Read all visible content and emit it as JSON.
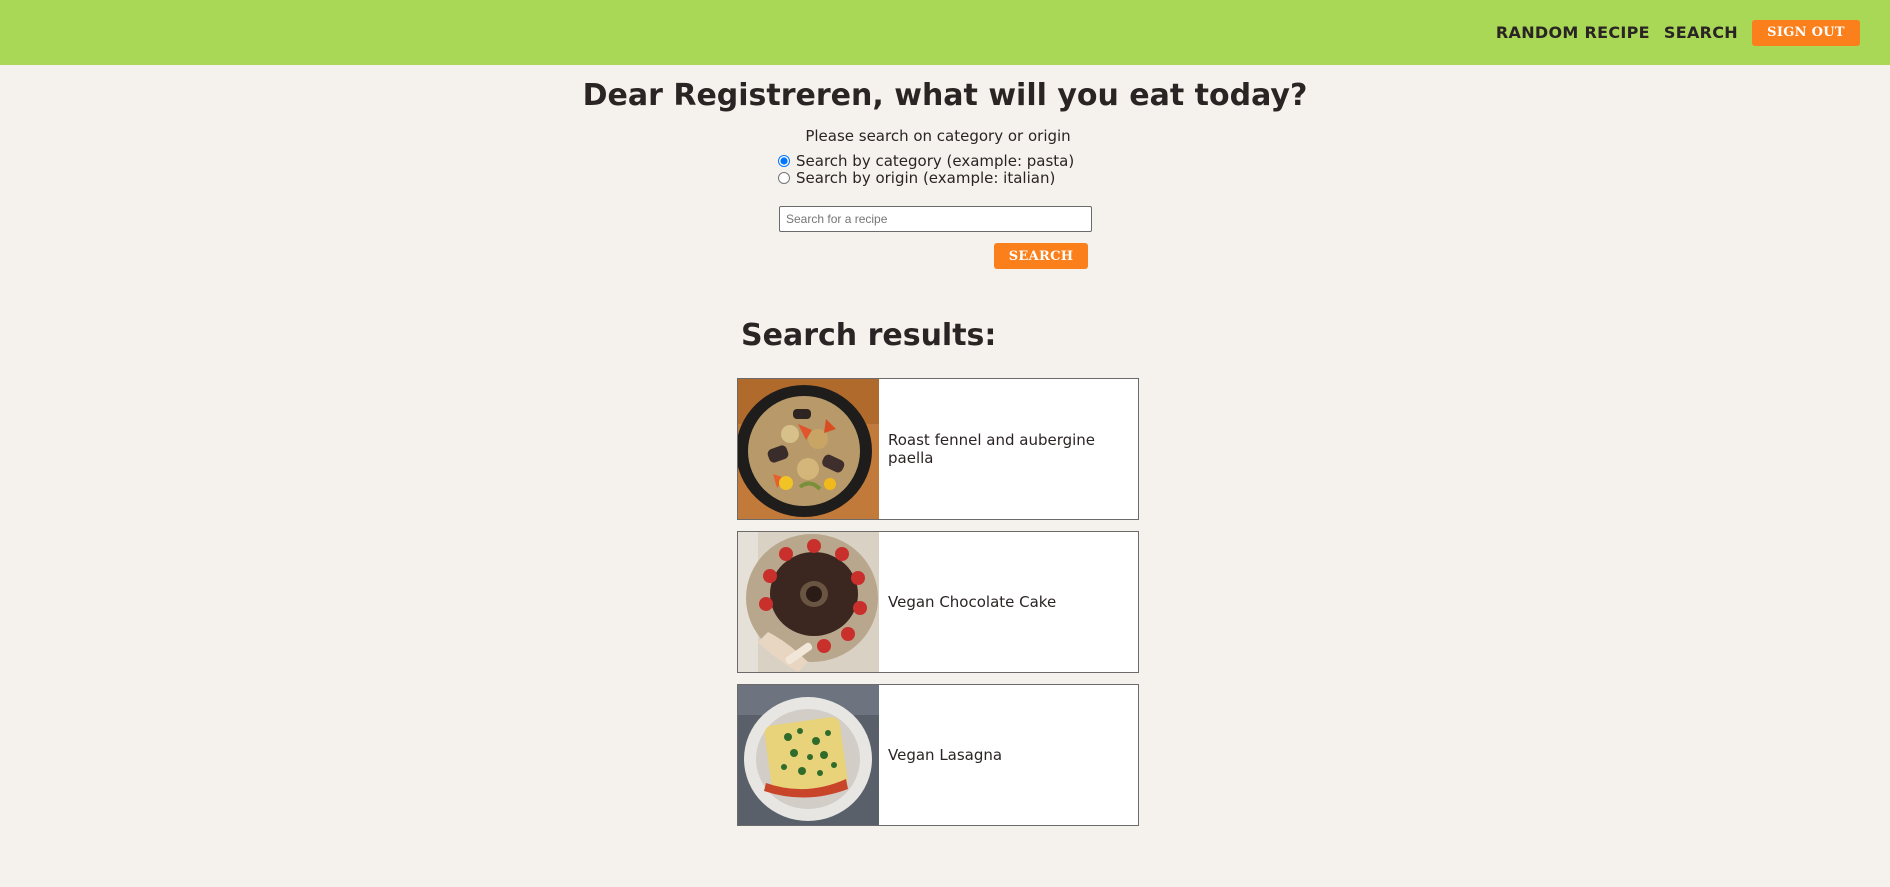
{
  "header": {
    "nav": {
      "random_recipe": "RANDOM RECIPE",
      "search": "SEARCH",
      "sign_out": "SIGN OUT"
    },
    "accent_color": "#a8d856",
    "button_color": "#fb7f1a"
  },
  "main": {
    "title": "Dear Registreren, what will you eat today?",
    "hint": "Please search on category or origin",
    "options": [
      {
        "label": "Search by category (example: pasta)",
        "checked": true
      },
      {
        "label": "Search by origin (example: italian)",
        "checked": false
      }
    ],
    "search": {
      "placeholder": "Search for a recipe",
      "value": "",
      "button_label": "SEARCH"
    }
  },
  "results": {
    "title": "Search results:",
    "items": [
      {
        "name": "Roast fennel and aubergine paella",
        "image": "paella-photo"
      },
      {
        "name": "Vegan Chocolate Cake",
        "image": "chocolate-cake-photo"
      },
      {
        "name": "Vegan Lasagna",
        "image": "lasagna-photo"
      }
    ]
  }
}
